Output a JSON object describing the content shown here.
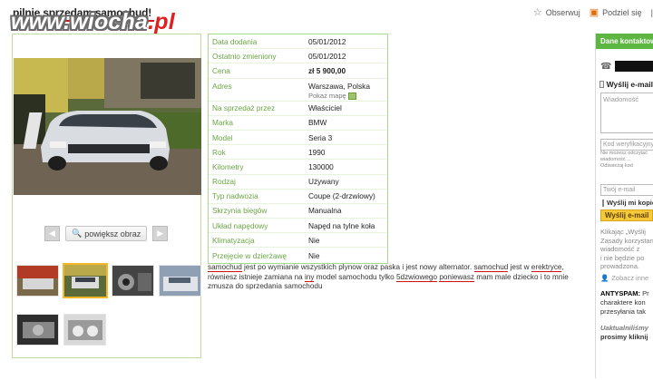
{
  "header": {
    "title": "pilnie sprzedam samochud!",
    "watermark": "www.wiocha",
    "watermark_tld": ".pl",
    "actions": [
      {
        "label": "Obserwuj",
        "icon": "star-icon"
      },
      {
        "label": "Podziel się",
        "icon": "share-icon"
      }
    ],
    "close_mark": "|"
  },
  "gallery": {
    "zoom_label": "powiększ obraz",
    "prev_icon": "chevron-left-icon",
    "next_icon": "chevron-right-icon",
    "thumb_count": 6,
    "active_thumb": 2
  },
  "details": [
    {
      "label": "Data dodania",
      "value": "05/01/2012"
    },
    {
      "label": "Ostatnio zmieniony",
      "value": "05/01/2012"
    },
    {
      "label": "Cena",
      "value": "zł 5 900,00"
    },
    {
      "label": "Adres",
      "value": "Warszawa, Polska",
      "link": "Pokaż mapę"
    },
    {
      "label": "Na sprzedaż przez",
      "value": "Właściciel"
    },
    {
      "label": "Marka",
      "value": "BMW"
    },
    {
      "label": "Model",
      "value": "Seria 3"
    },
    {
      "label": "Rok",
      "value": "1990"
    },
    {
      "label": "Kilometry",
      "value": "130000"
    },
    {
      "label": "Rodzaj",
      "value": "Używany"
    },
    {
      "label": "Typ nadwozia",
      "value": "Coupe (2-drzwiowy)"
    },
    {
      "label": "Skrzynia biegów",
      "value": "Manualna"
    },
    {
      "label": "Układ napędowy",
      "value": "Napęd na tylne koła"
    },
    {
      "label": "Klimatyzacja",
      "value": "Nie"
    },
    {
      "label": "Przejęcie w dzierżawę",
      "value": "Nie"
    }
  ],
  "description": {
    "w1": "samochud",
    "t1": " jest po wymianie wszystkich plynow oraz paska i jest nowy alternator. ",
    "w2": "samochud",
    "t2": " jest w ",
    "w3": "erektryce",
    "t3": ", równiesz istnieje zamiana na ",
    "w4": "iny",
    "t4": " model samochodu tylko ",
    "w5": "5dzwiowego",
    "t5": " ",
    "w6": "poniewasz",
    "t6": " mam male dziecko i to mnie zmusza do sprzedania samochodu"
  },
  "sidebar": {
    "header": "Dane kontaktowe",
    "send_title": "Wyślij e-mail",
    "message_placeholder": "Wiadomość",
    "code_placeholder": "Kod weryfikacyjny",
    "note1": "Nie możesz odczytać",
    "note2": "wiadomość ...",
    "refresh_code": "Odświeżaj kod",
    "email_placeholder": "Twój e-mail",
    "copy_label": "Wyślij mi kopię",
    "send_button": "Wyślij e-mail",
    "text1": "Klikając „Wyślij",
    "text2": "Zasady korzystania",
    "text3": "wiadomość z",
    "text4": "i nie będzie po",
    "text5": "prowadzona.",
    "see_label": "Zobacz inne",
    "antispam_title": "ANTYSPAM:",
    "antispam_text": " Pr",
    "antispam_l2": "charaktere kon",
    "antispam_l3": "przesyłania tak",
    "bottom1": "Uaktualniliśmy",
    "bottom2": "prosimy kliknij"
  }
}
